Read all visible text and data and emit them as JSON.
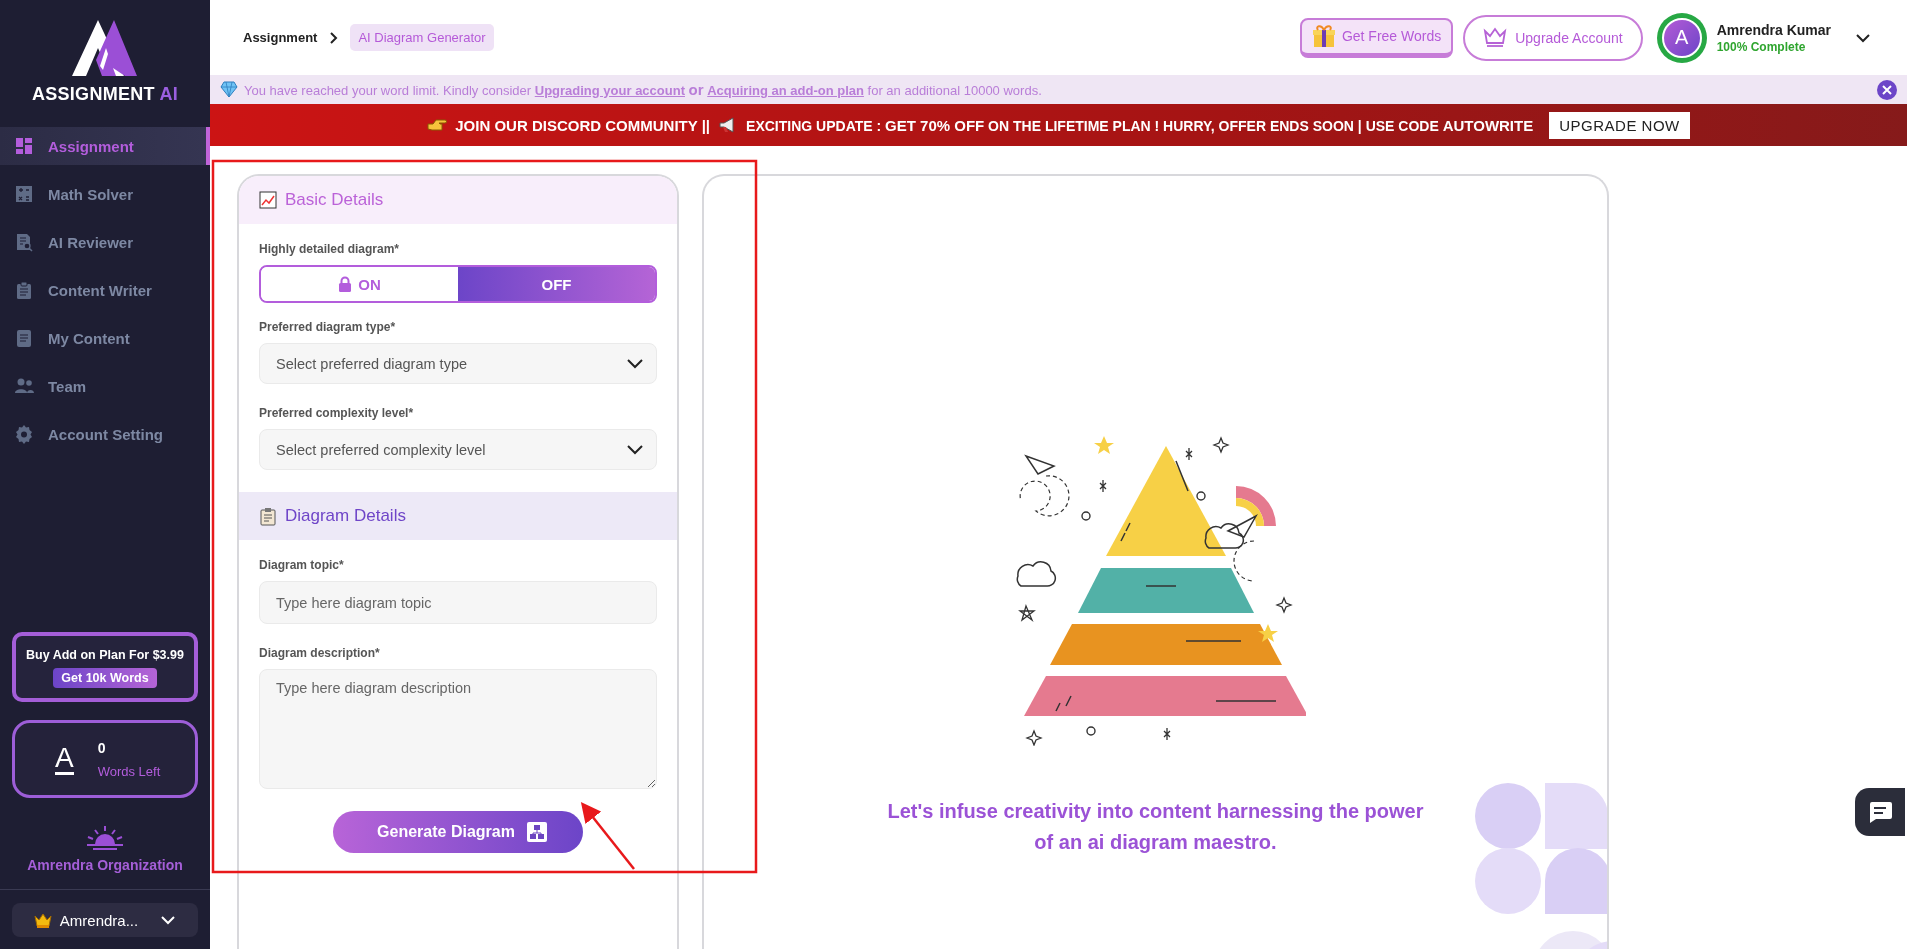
{
  "sidebar": {
    "logo": {
      "word": "ASSIGNMENT",
      "accent": "AI"
    },
    "items": [
      {
        "label": "Assignment",
        "selected": true
      },
      {
        "label": "Math Solver",
        "selected": false
      },
      {
        "label": "AI Reviewer",
        "selected": false
      },
      {
        "label": "Content Writer",
        "selected": false
      },
      {
        "label": "My Content",
        "selected": false
      },
      {
        "label": "Team",
        "selected": false
      },
      {
        "label": "Account Setting",
        "selected": false
      }
    ],
    "promo": {
      "title": "Buy Add on Plan For $3.99",
      "button": "Get 10k Words"
    },
    "words": {
      "icon_text": "A",
      "count": "0",
      "label": "Words Left"
    },
    "organization": "Amrendra Organization",
    "account_menu": {
      "label": "Amrendra..."
    }
  },
  "breadcrumb": [
    {
      "label": "Assignment",
      "selected": false
    },
    {
      "label": "AI Diagram Generator",
      "selected": true
    }
  ],
  "header": {
    "free_words": "Get Free Words",
    "upgrade": "Upgrade Account",
    "profile": {
      "initial": "A",
      "name": "Amrendra Kumar",
      "completion": "100% Complete",
      "level": 1
    }
  },
  "notice": {
    "parts": [
      {
        "kind": "text",
        "text": "You have reached your word limit. Kindly consider"
      },
      {
        "kind": "link",
        "text": "Upgrading your account"
      },
      {
        "kind": "or",
        "text": "or"
      },
      {
        "kind": "link",
        "text": "Acquiring an add-on plan"
      },
      {
        "kind": "text",
        "text": "for an additional 10000 words."
      }
    ]
  },
  "banner": {
    "messages": [
      "**JOIN OUR DISCORD COMMUNITY ||**",
      "EXCITING UPDATE : **GET 70% OFF** ON THE LIFETIME PLAN ! HURRY, OFFER ENDS SOON | USE CODE **AUTOWRITE**"
    ],
    "button": "UPGRADE NOW"
  },
  "form": {
    "sections": [
      {
        "title": "Basic Details",
        "fields": [
          {
            "kind": "toggle",
            "label": "Highly detailed diagram*",
            "options": [
              {
                "label": "ON",
                "selected": false,
                "locked": true
              },
              {
                "label": "OFF",
                "selected": true,
                "locked": false
              }
            ]
          },
          {
            "kind": "select",
            "label": "Preferred diagram type*",
            "placeholder": "Select preferred diagram type"
          },
          {
            "kind": "select",
            "label": "Preferred complexity level*",
            "placeholder": "Select preferred complexity level"
          }
        ]
      },
      {
        "title": "Diagram Details",
        "fields": [
          {
            "kind": "input",
            "label": "Diagram topic*",
            "placeholder": "Type here diagram topic"
          },
          {
            "kind": "textarea",
            "label": "Diagram description*",
            "placeholder": "Type here diagram description"
          }
        ]
      }
    ],
    "submit": "Generate Diagram"
  },
  "preview": {
    "caption": "Let's infuse creativity into content harnessing the power of an ai diagram maestro."
  }
}
